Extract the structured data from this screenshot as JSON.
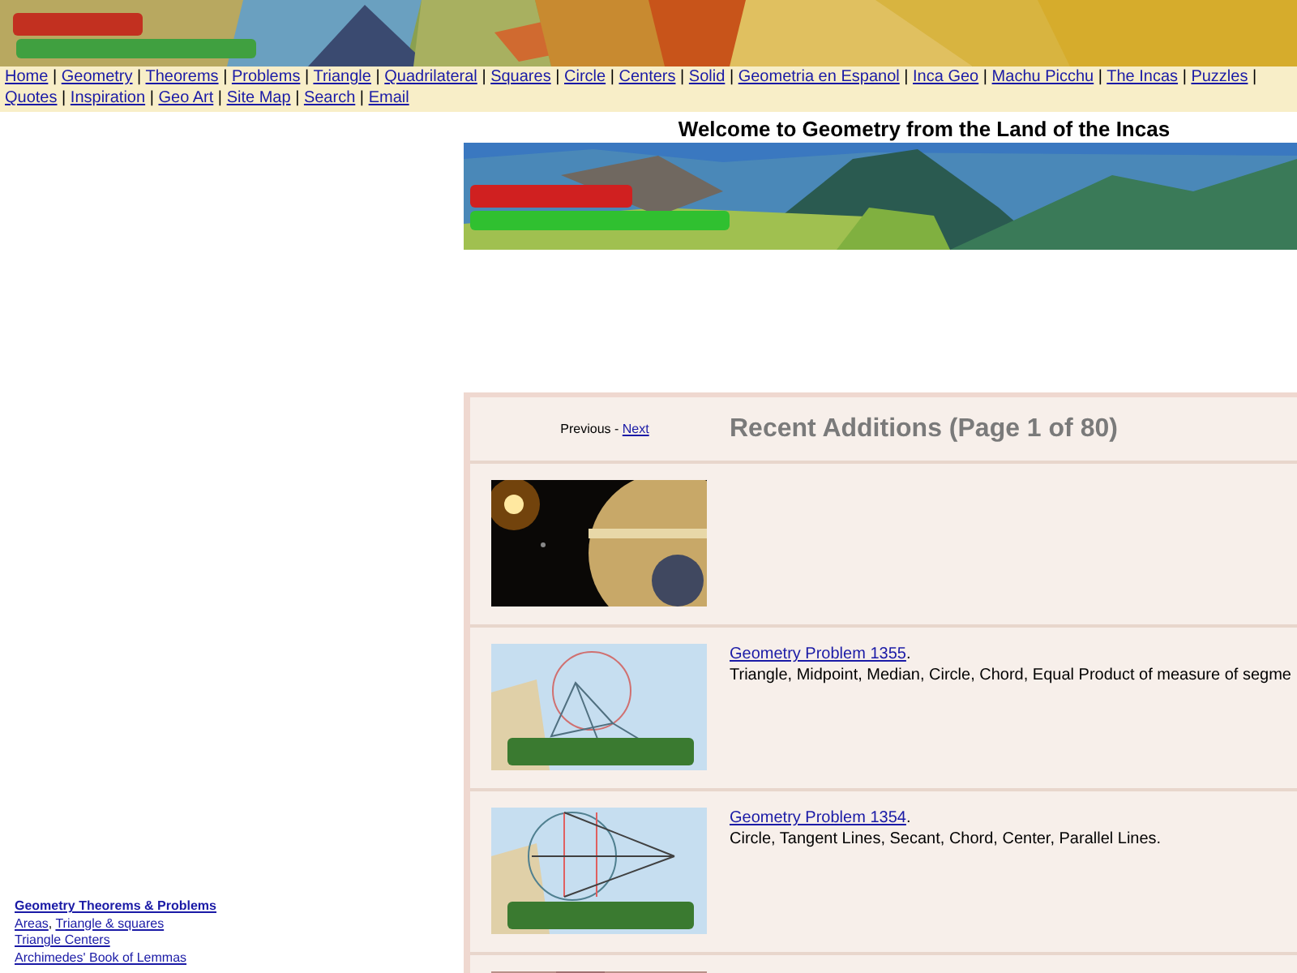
{
  "nav": {
    "separator": "|",
    "links": [
      "Home",
      "Geometry",
      "Theorems",
      "Problems",
      "Triangle",
      "Quadrilateral",
      "Squares",
      "Circle",
      "Centers",
      "Solid",
      "Geometria en Espanol",
      "Inca Geo",
      "Machu Picchu",
      "The Incas",
      "Puzzles",
      "Quotes",
      "Inspiration",
      "Geo Art",
      "Site Map",
      "Search",
      "Email"
    ]
  },
  "welcome": "Welcome to Geometry from the Land of the Incas",
  "sidebar": {
    "lines": [
      {
        "links": [
          "Geometry Theorems & Problems"
        ],
        "bold": true
      },
      {
        "separator": ",",
        "links": [
          "Areas",
          "Triangle & squares"
        ],
        "bold": false
      },
      {
        "links": [
          "Triangle Centers"
        ],
        "bold": false
      },
      {
        "links": [
          "Archimedes' Book of Lemmas"
        ],
        "bold": false
      }
    ]
  },
  "recent": {
    "pager": {
      "previous": "Previous",
      "separator": "-",
      "next": "Next"
    },
    "title": "Recent Additions (Page 1 of 80)",
    "rows": [
      {
        "kind": "intro"
      },
      {
        "kind": "problem",
        "link": "Geometry Problem 1355",
        "suffix": ".",
        "description": "Triangle, Midpoint, Median, Circle, Chord, Equal Product of measure of segme"
      },
      {
        "kind": "problem",
        "link": "Geometry Problem 1354",
        "suffix": ".",
        "description": "Circle, Tangent Lines, Secant, Chord, Center, Parallel Lines."
      },
      {
        "kind": "partial"
      }
    ]
  }
}
